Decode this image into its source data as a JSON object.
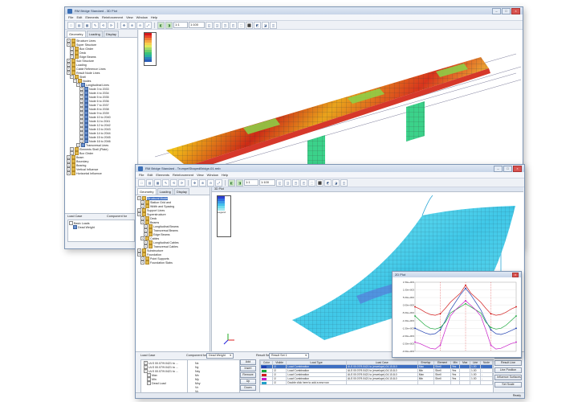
{
  "back_window": {
    "title": "RM Bridge Standard - 3D Plot",
    "menu": [
      "File",
      "Edit",
      "Elements",
      "Reinforcement",
      "View",
      "Window",
      "Help"
    ],
    "toolbar": {
      "zoom_value": "1:1",
      "scale_value": "1:100"
    },
    "tabs": [
      "Geometry",
      "Loading",
      "Display"
    ],
    "tree": [
      {
        "label": "Structure Lines",
        "level": 0
      },
      {
        "label": "Super Structure",
        "level": 0
      },
      {
        "label": "Box Girder",
        "level": 1
      },
      {
        "label": "Deck",
        "level": 1
      },
      {
        "label": "Edge Beams",
        "level": 1
      },
      {
        "label": "Sub Structure",
        "level": 0
      },
      {
        "label": "Loading",
        "level": 0
      },
      {
        "label": "Cable Reference Lines",
        "level": 0
      },
      {
        "label": "Result Node Lines",
        "level": 0
      },
      {
        "label": "Shell",
        "level": 1
      },
      {
        "label": "Nodes",
        "level": 2
      },
      {
        "label": "Longitudinal Lines",
        "level": 3
      },
      {
        "label": "Node 3 to 2033",
        "level": 4
      },
      {
        "label": "Node 4 to 2034",
        "level": 4
      },
      {
        "label": "Node 5 to 2035",
        "level": 4
      },
      {
        "label": "Node 6 to 2036",
        "level": 4
      },
      {
        "label": "Node 7 to 2037",
        "level": 4
      },
      {
        "label": "Node 8 to 2038",
        "level": 4
      },
      {
        "label": "Node 9 to 2039",
        "level": 4
      },
      {
        "label": "Node 10 to 2040",
        "level": 4
      },
      {
        "label": "Node 11 to 2041",
        "level": 4
      },
      {
        "label": "Node 12 to 2042",
        "level": 4
      },
      {
        "label": "Node 13 to 2043",
        "level": 4
      },
      {
        "label": "Node 14 to 2044",
        "level": 4
      },
      {
        "label": "Node 15 to 2045",
        "level": 4
      },
      {
        "label": "Node 16 to 2046",
        "level": 4
      },
      {
        "label": "Transversal Lines",
        "level": 3
      },
      {
        "label": "Elements Shell (Plate)",
        "level": 1
      },
      {
        "label": "Box Girder",
        "level": 1
      },
      {
        "label": "Beam",
        "level": 0
      },
      {
        "label": "Boundary",
        "level": 0
      },
      {
        "label": "Bearing",
        "level": 0
      },
      {
        "label": "Vertical Influence",
        "level": 0
      },
      {
        "label": "Horizontal Influence",
        "level": 0
      }
    ],
    "load_case_title": "Load Case",
    "component_label": "Component for",
    "load_items": [
      "Basic Loads",
      "Dead Weight"
    ],
    "status_text": ""
  },
  "front_window": {
    "title": "RM Bridge Standard - TrumpetShapedBridge-01.rmb",
    "menu": [
      "File",
      "Edit",
      "Elements",
      "Reinforcement",
      "View",
      "Window",
      "Help"
    ],
    "toolbar": {
      "zoom_value": "1:1",
      "scale_value": "1:100"
    },
    "tabs": [
      "Geometry",
      "Loading",
      "Display"
    ],
    "tree": [
      {
        "label": "Structural Model",
        "level": 0,
        "selected": true
      },
      {
        "label": "Station Grid and",
        "level": 1
      },
      {
        "label": "Width and Spacing",
        "level": 1
      },
      {
        "label": "Support Lines",
        "level": 0
      },
      {
        "label": "Superstructure",
        "level": 0
      },
      {
        "label": "Deck",
        "level": 1
      },
      {
        "label": "Beams",
        "level": 1
      },
      {
        "label": "Longitudinal Beams",
        "level": 2
      },
      {
        "label": "Transversal Beams",
        "level": 2
      },
      {
        "label": "Edge Beams",
        "level": 2
      },
      {
        "label": "Cables",
        "level": 1
      },
      {
        "label": "Longitudinal Cables",
        "level": 2
      },
      {
        "label": "Transversal Cables",
        "level": 2
      },
      {
        "label": "Substructure",
        "level": 0
      },
      {
        "label": "Foundation",
        "level": 0
      },
      {
        "label": "Point Supports",
        "level": 1
      },
      {
        "label": "Foundation Slabs",
        "level": 1
      }
    ],
    "viewport_title": "3D Plot",
    "legend_caption": "Legend",
    "load_case_title": "Load Case",
    "component_label": "Component for",
    "component_value": "Dead Weight",
    "result_set_label": "Result Set",
    "result_set_value": "Result Set 1",
    "load_items": [
      "ULS 00.07/9.0421 to ...",
      "ULS 00.07/9.0421 to ...",
      "ULS 00.07/9.0421 to ...",
      "Max",
      "Min",
      "Dead Load"
    ],
    "component_items": [
      "Nx",
      "Ny",
      "Nxy",
      "Mx",
      "My",
      "Mxy",
      "Vx",
      "Vy"
    ],
    "mid_buttons": [
      "Add",
      "Insert",
      "Remove",
      "Up",
      "Down"
    ],
    "table_headers": [
      "Color",
      "Visible",
      "Load Type",
      "Load Case",
      "Envelop",
      "Element",
      "Min",
      "Max",
      "Line",
      "Node"
    ],
    "table_rows": [
      {
        "color": "#1f3fb0",
        "type": "Load Combination",
        "case": "ULS 00.07/9.0421 to (envelope) 04.10-8-0",
        "env": "Max",
        "elem": "Shell",
        "min": "Yes",
        "max": "",
        "line": "1.00",
        "node": "-"
      },
      {
        "color": "#19a83a",
        "type": "Load Combination",
        "case": "ULS 00.07/9.0421 to (envelope) 04.10-8-0",
        "env": "Min",
        "elem": "Shell",
        "min": "Yes",
        "max": "",
        "line": "1.00",
        "node": "-"
      },
      {
        "color": "#d21e1e",
        "type": "Load Combination",
        "case": "ULS 00.07/9.0421 to (envelope) 04.10-8-0",
        "env": "Max",
        "elem": "Shell",
        "min": "Yes",
        "max": "",
        "line": "1.00",
        "node": "-"
      },
      {
        "color": "#c81ec8",
        "type": "Load Combination",
        "case": "ULS 00.07/9.0421 to (envelope) 04.10-8-0",
        "env": "Min",
        "elem": "Shell",
        "min": "Yes",
        "max": "",
        "line": "1.00",
        "node": "-"
      },
      {
        "color": "#20a0c8",
        "type": "Double click here to add a new row",
        "case": "",
        "env": "",
        "elem": "",
        "min": "",
        "max": "",
        "line": "",
        "node": ""
      }
    ],
    "right_buttons": [
      "Edit Result Mode",
      "Result Line",
      "Line Position",
      "Influence Surfaces",
      "Set Scale"
    ],
    "status_text": "Ready",
    "colors": {
      "accent": "#3d6ec2",
      "frame": "#7f96b4"
    }
  },
  "chart_window": {
    "title": "2D Plot",
    "y_ticks": [
      "1.50e+003",
      "1.00e+003",
      "5.00e+002",
      "0.00e+000",
      "-5.00e+002",
      "-1.00e+003",
      "-1.50e+003",
      "-2.00e+003",
      "-2.50e+003",
      "-3.00e+003"
    ]
  },
  "chart_data": {
    "type": "line",
    "xlabel": "",
    "ylabel": "",
    "ylim": [
      -3000,
      1500
    ],
    "x": [
      0,
      0.05,
      0.1,
      0.15,
      0.2,
      0.25,
      0.3,
      0.35,
      0.4,
      0.45,
      0.5,
      0.55,
      0.6,
      0.65,
      0.7,
      0.75,
      0.8,
      0.85,
      0.9,
      0.95,
      1.0
    ],
    "series": [
      {
        "color": "#1f3fb0",
        "values": [
          -1500,
          -1650,
          -1800,
          -1900,
          -1850,
          -1600,
          -1000,
          -300,
          200,
          700,
          1100,
          700,
          200,
          -300,
          -1000,
          -1600,
          -1850,
          -1900,
          -1800,
          -1650,
          -1500
        ]
      },
      {
        "color": "#19a83a",
        "values": [
          -700,
          -1000,
          -1300,
          -1500,
          -1550,
          -1450,
          -1100,
          -500,
          -300,
          -100,
          100,
          -100,
          -300,
          -500,
          -1100,
          -1450,
          -1550,
          -1500,
          -1300,
          -1000,
          -700
        ]
      },
      {
        "color": "#d21e1e",
        "values": [
          -100,
          -250,
          -450,
          -600,
          -650,
          -550,
          -200,
          200,
          500,
          800,
          1300,
          800,
          500,
          200,
          -200,
          -550,
          -650,
          -600,
          -450,
          -250,
          -100
        ]
      },
      {
        "color": "#c81ec8",
        "values": [
          -2400,
          -2500,
          -2650,
          -2800,
          -2850,
          -2600,
          -1600,
          -700,
          -300,
          0,
          300,
          0,
          -300,
          -700,
          -1600,
          -2600,
          -2850,
          -2800,
          -2650,
          -2500,
          -2400
        ]
      }
    ],
    "grid": true
  }
}
